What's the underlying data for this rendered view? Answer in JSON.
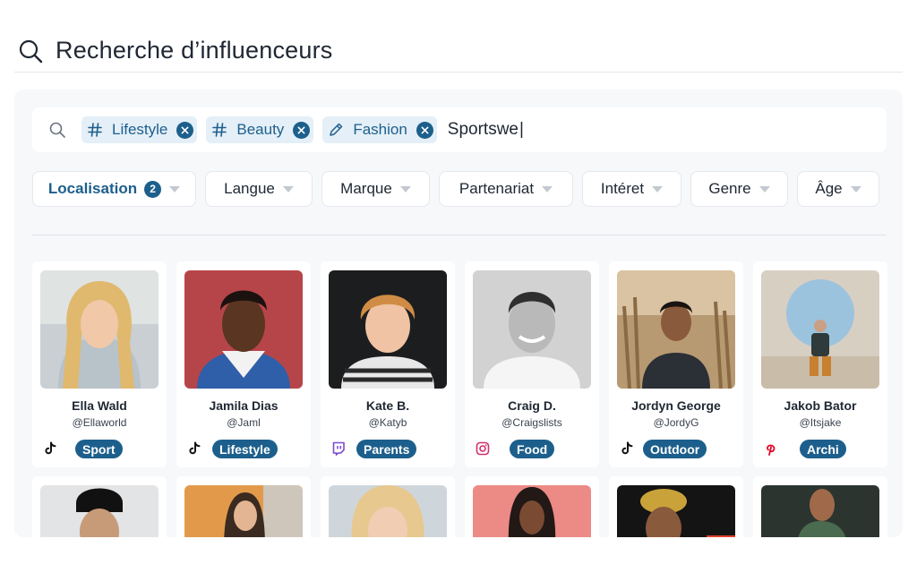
{
  "header": {
    "title": "Recherche d’influenceurs"
  },
  "search": {
    "chips": [
      {
        "label": "Lifestyle",
        "icon": "hashtag-icon"
      },
      {
        "label": "Beauty",
        "icon": "hashtag-icon"
      },
      {
        "label": "Fashion",
        "icon": "pencil-icon"
      }
    ],
    "typed_value": "Sportswe"
  },
  "filters": [
    {
      "label": "Localisation",
      "badge": "2",
      "active": true
    },
    {
      "label": "Langue"
    },
    {
      "label": "Marque"
    },
    {
      "label": "Partenariat"
    },
    {
      "label": "Intéret"
    },
    {
      "label": "Genre"
    },
    {
      "label": "Âge"
    }
  ],
  "influencers": [
    {
      "name": "Ella Wald",
      "handle": "@Ellaworld",
      "network": "tiktok-icon",
      "tag": "Sport"
    },
    {
      "name": "Jamila Dias",
      "handle": "@Jaml",
      "network": "tiktok-icon",
      "tag": "Lifestyle"
    },
    {
      "name": "Kate B.",
      "handle": "@Katyb",
      "network": "twitch-icon",
      "tag": "Parents"
    },
    {
      "name": "Craig D.",
      "handle": "@Craigslists",
      "network": "instagram-icon",
      "tag": "Food"
    },
    {
      "name": "Jordyn George",
      "handle": "@JordyG",
      "network": "tiktok-icon",
      "tag": "Outdoor"
    },
    {
      "name": "Jakob Bator",
      "handle": "@Itsjake",
      "network": "pinterest-icon",
      "tag": "Archi"
    }
  ],
  "colors": {
    "accent": "#1d5f8c",
    "chip_bg": "#e4eff7",
    "panel_bg": "#f6f8fa"
  }
}
